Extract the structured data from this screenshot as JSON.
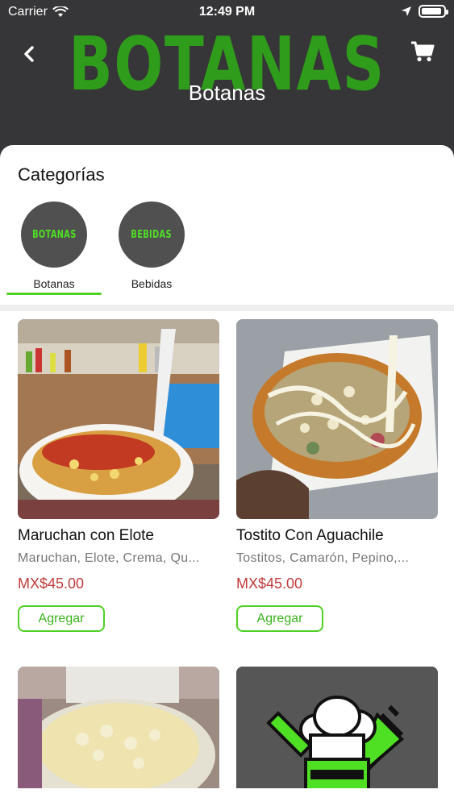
{
  "status_bar": {
    "carrier": "Carrier",
    "time": "12:49 PM"
  },
  "header": {
    "brand": "BOTANAS",
    "title": "Botanas",
    "back_icon": "chevron-left-icon",
    "cart_icon": "cart-icon"
  },
  "categories": {
    "heading": "Categorías",
    "items": [
      {
        "label": "Botanas",
        "badge": "BOTANAS",
        "selected": true
      },
      {
        "label": "Bebidas",
        "badge": "BEBIDAS",
        "selected": false
      }
    ]
  },
  "products": [
    {
      "name": "Maruchan con Elote",
      "description": "Maruchan, Elote, Crema, Qu...",
      "price": "MX$45.00",
      "button": "Agregar"
    },
    {
      "name": "Tostito Con Aguachile",
      "description": "Tostitos, Camarón, Pepino,...",
      "price": "MX$45.00",
      "button": "Agregar"
    }
  ],
  "colors": {
    "header_bg": "#363537",
    "accent_green": "#4fd024",
    "price_red": "#c13a3a"
  }
}
